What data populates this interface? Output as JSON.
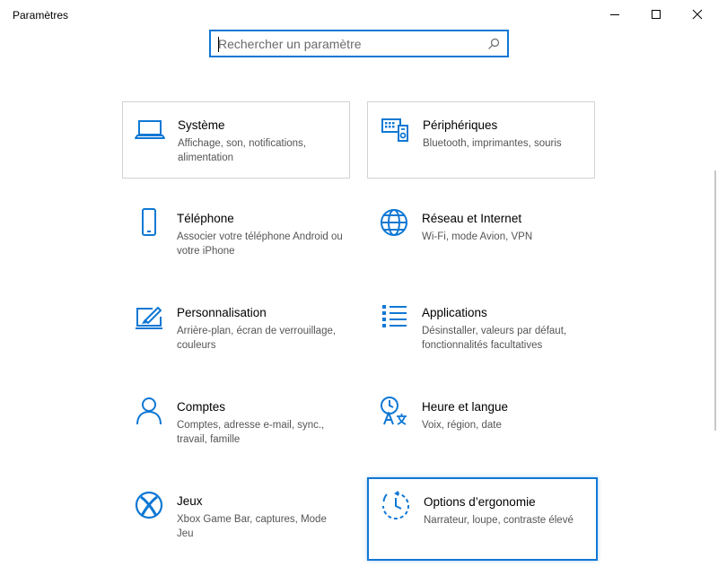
{
  "window": {
    "title": "Paramètres",
    "minimize_icon": "minimize-icon",
    "maximize_icon": "maximize-icon",
    "close_icon": "close-icon"
  },
  "search": {
    "placeholder": "Rechercher un paramètre",
    "value": "",
    "icon": "search-icon"
  },
  "accent_color": "#0f78d4",
  "categories": [
    {
      "title": "Système",
      "desc": "Affichage, son, notifications, alimentation",
      "icon": "laptop-icon"
    },
    {
      "title": "Périphériques",
      "desc": "Bluetooth, imprimantes, souris",
      "icon": "devices-icon"
    },
    {
      "title": "Téléphone",
      "desc": "Associer votre téléphone Android ou votre iPhone",
      "icon": "phone-icon"
    },
    {
      "title": "Réseau et Internet",
      "desc": "Wi-Fi, mode Avion, VPN",
      "icon": "globe-icon"
    },
    {
      "title": "Personnalisation",
      "desc": "Arrière-plan, écran de verrouillage, couleurs",
      "icon": "personalization-icon"
    },
    {
      "title": "Applications",
      "desc": "Désinstaller, valeurs par défaut, fonctionnalités facultatives",
      "icon": "apps-list-icon"
    },
    {
      "title": "Comptes",
      "desc": "Comptes, adresse e-mail, sync., travail, famille",
      "icon": "person-icon"
    },
    {
      "title": "Heure et langue",
      "desc": "Voix, région, date",
      "icon": "time-language-icon"
    },
    {
      "title": "Jeux",
      "desc": "Xbox Game Bar, captures, Mode Jeu",
      "icon": "xbox-icon"
    },
    {
      "title": "Options d’ergonomie",
      "desc": "Narrateur, loupe, contraste élevé",
      "icon": "ease-of-access-icon"
    }
  ]
}
